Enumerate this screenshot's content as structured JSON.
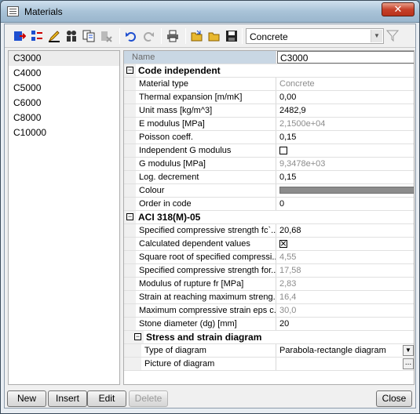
{
  "window": {
    "title": "Materials"
  },
  "toolbar": {
    "material_type_selected": "Concrete",
    "icons": [
      "import-icon",
      "material-library-icon",
      "pencil-icon",
      "group-icon",
      "copy-icon",
      "delete-icon",
      "undo-icon",
      "redo-icon",
      "print-icon",
      "open-folder-icon",
      "open-icon",
      "save-icon",
      "filter-icon"
    ]
  },
  "materials": [
    "C3000",
    "C4000",
    "C5000",
    "C6000",
    "C8000",
    "C10000"
  ],
  "selected_material": "C3000",
  "properties": {
    "name_label": "Name",
    "name_value": "C3000",
    "section_code_independent": "Code independent",
    "material_type_label": "Material type",
    "material_type_value": "Concrete",
    "thermal_label": "Thermal expansion  [m/mK]",
    "thermal_value": "0,00",
    "unit_mass_label": "Unit mass [kg/m^3]",
    "unit_mass_value": "2482,9",
    "e_modulus_label": "E modulus [MPa]",
    "e_modulus_value": "2,1500e+04",
    "poisson_label": "Poisson coeff.",
    "poisson_value": "0,15",
    "indep_g_label": "Independent G modulus",
    "g_modulus_label": "G modulus [MPa]",
    "g_modulus_value": "9,3478e+03",
    "log_decrement_label": "Log. decrement",
    "log_decrement_value": "0,15",
    "colour_label": "Colour",
    "colour_value": "#8c8c8c",
    "order_label": "Order in code",
    "order_value": "0",
    "section_aci": "ACI 318(M)-05",
    "fc_label": "Specified compressive strength fc`...",
    "fc_value": "20,68",
    "calc_dependent_label": "Calculated dependent values",
    "sqrt_fc_label": "Square root of specified compressi...",
    "sqrt_fc_value": "4,55",
    "fc_for_label": "Specified compressive strength for...",
    "fc_for_value": "17,58",
    "rupture_label": "Modulus of rupture fr  [MPa]",
    "rupture_value": "2,83",
    "strain_max_label": "Strain at reaching maximum streng...",
    "strain_max_value": "16,4",
    "max_strain_label": "Maximum compressive strain eps c...",
    "max_strain_value": "30,0",
    "stone_label": "Stone diameter (dg) [mm]",
    "stone_value": "20",
    "section_stress": "Stress and strain diagram",
    "diagram_type_label": "Type of diagram",
    "diagram_type_value": "Parabola-rectangle diagram",
    "diagram_picture_label": "Picture of diagram",
    "diagram_picture_btn": "..."
  },
  "buttons": {
    "new": "New",
    "insert": "Insert",
    "edit": "Edit",
    "delete": "Delete",
    "close": "Close"
  }
}
